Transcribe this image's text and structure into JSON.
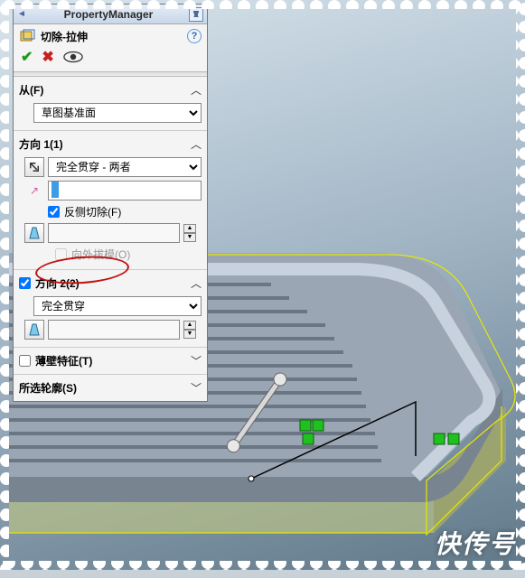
{
  "header": {
    "title": "PropertyManager"
  },
  "feature": {
    "name": "切除-拉伸"
  },
  "from_section": {
    "title": "从(F)",
    "start_condition": "草图基准面"
  },
  "dir1": {
    "title": "方向 1(1)",
    "end_condition": "完全贯穿 - 两者",
    "depth_value": "",
    "flip_side_label": "反侧切除(F)",
    "flip_side_checked": true,
    "draft_outward_label": "向外拔模(O)",
    "draft_outward_checked": false
  },
  "dir2": {
    "title": "方向 2(2)",
    "enabled": true,
    "end_condition": "完全贯穿"
  },
  "thin": {
    "title": "薄壁特征(T)",
    "enabled": false
  },
  "contours": {
    "title": "所选轮廓(S)"
  },
  "watermark": "快传号"
}
